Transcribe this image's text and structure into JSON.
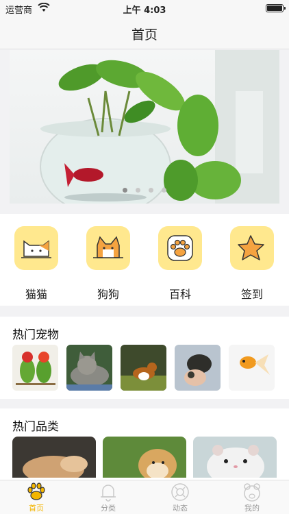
{
  "status_bar": {
    "carrier": "运营商",
    "time": "上午 4:03"
  },
  "nav": {
    "title": "首页"
  },
  "banner": {
    "slides": 4,
    "active_index": 0
  },
  "quick_actions": [
    {
      "label": "猫猫",
      "icon": "cat-icon"
    },
    {
      "label": "狗狗",
      "icon": "dog-icon"
    },
    {
      "label": "百科",
      "icon": "paw-icon"
    },
    {
      "label": "签到",
      "icon": "star-icon"
    }
  ],
  "hot_pets": {
    "title": "热门宠物",
    "items": [
      "parrots-photo",
      "cat-photo",
      "collie-photo",
      "turtle-photo",
      "goldfish-photo"
    ]
  },
  "hot_categories": {
    "title": "热门品类",
    "items": [
      "cat-photo",
      "golden-retriever-photo",
      "hamster-photo"
    ]
  },
  "tabs": [
    {
      "label": "首页",
      "icon": "paw-icon",
      "active": true
    },
    {
      "label": "分类",
      "icon": "bell-icon",
      "active": false
    },
    {
      "label": "动态",
      "icon": "lifebuoy-icon",
      "active": false
    },
    {
      "label": "我的",
      "icon": "bear-icon",
      "active": false
    }
  ],
  "colors": {
    "accent": "#f3b500",
    "icon_bg": "#ffe88e",
    "inactive_tab": "#999999"
  }
}
